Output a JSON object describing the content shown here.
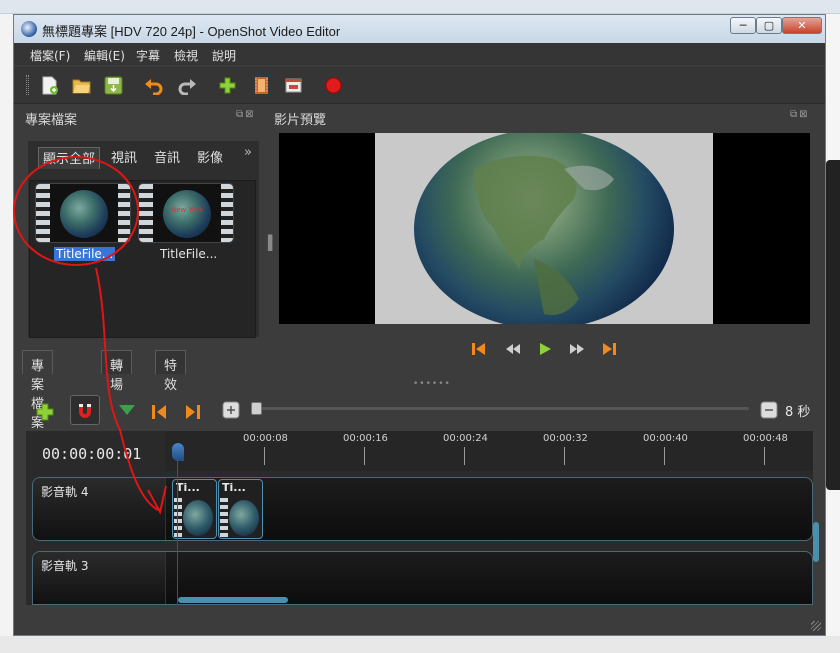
{
  "window": {
    "title": "無標題專案 [HDV 720 24p] - OpenShot Video Editor",
    "minimize": "─",
    "maximize": "▢",
    "close": "✕"
  },
  "menu": [
    "檔案(F)",
    "編輯(E)",
    "字幕",
    "檢視",
    "說明"
  ],
  "toolbar": {
    "icons": [
      "new-file-icon",
      "open-folder-icon",
      "save-icon",
      "undo-icon",
      "redo-icon",
      "add-icon",
      "film-icon",
      "fullscreen-icon",
      "record-icon"
    ]
  },
  "project_files": {
    "title": "專案檔案",
    "dock_buttons": "⧉⊠",
    "filters": [
      "顯示全部",
      "視訊",
      "音訊",
      "影像"
    ],
    "more": "»",
    "files": [
      {
        "label": "TitleFile...",
        "selected": true
      },
      {
        "label": "TitleFile...",
        "selected": false,
        "overlay": "New York"
      }
    ]
  },
  "bottom_tabs": [
    "專案檔案",
    "轉場",
    "特效"
  ],
  "preview": {
    "title": "影片預覽",
    "dock_buttons": "⧉⊠"
  },
  "player": {
    "controls": [
      "jump-start-icon",
      "rewind-icon",
      "play-icon",
      "fast-forward-icon",
      "jump-end-icon"
    ]
  },
  "timeline": {
    "current_time": "00:00:00:01",
    "zoom_label": "8 秒",
    "ruler": [
      "00:00:08",
      "00:00:16",
      "00:00:24",
      "00:00:32",
      "00:00:40",
      "00:00:48"
    ],
    "tracks": [
      {
        "name": "影音軌 4",
        "clips": [
          {
            "label": "Ti..."
          },
          {
            "label": "Ti..."
          }
        ]
      },
      {
        "name": "影音軌 3",
        "clips": []
      }
    ]
  },
  "colors": {
    "accent_orange": "#f08a1c",
    "play_green": "#8fd138",
    "selection_blue": "#3875d7",
    "annotation_red": "#e01515"
  }
}
